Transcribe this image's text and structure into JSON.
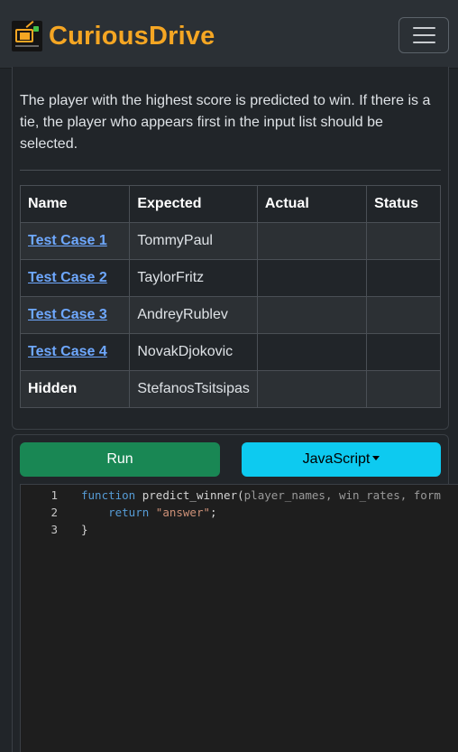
{
  "brand": {
    "name": "CuriousDrive"
  },
  "description": "The player with the highest score is predicted to win. If there is a tie, the player who appears first in the input list should be selected.",
  "table": {
    "headers": [
      "Name",
      "Expected",
      "Actual",
      "Status"
    ],
    "rows": [
      {
        "name": "Test Case 1",
        "expected": "TommyPaul",
        "actual": "",
        "status": ""
      },
      {
        "name": "Test Case 2",
        "expected": "TaylorFritz",
        "actual": "",
        "status": ""
      },
      {
        "name": "Test Case 3",
        "expected": "AndreyRublev",
        "actual": "",
        "status": ""
      },
      {
        "name": "Test Case 4",
        "expected": "NovakDjokovic",
        "actual": "",
        "status": ""
      },
      {
        "name": "Hidden",
        "expected": "StefanosTsitsipas",
        "actual": "",
        "status": ""
      }
    ]
  },
  "actions": {
    "run_label": "Run",
    "language_label": "JavaScript"
  },
  "editor": {
    "line_numbers": [
      "1",
      "2",
      "3"
    ],
    "line1": {
      "keyword": "function",
      "name": " predict_winner(",
      "params": "player_names, win_rates, form"
    },
    "line2": {
      "indent": "    ",
      "keyword": "return",
      "space": " ",
      "string": "\"answer\"",
      "end": ";"
    },
    "line3": {
      "text": "}"
    }
  },
  "colors": {
    "brand": "#f5a623",
    "run": "#198754",
    "language": "#0dcaf0",
    "link": "#6ea8fe"
  }
}
